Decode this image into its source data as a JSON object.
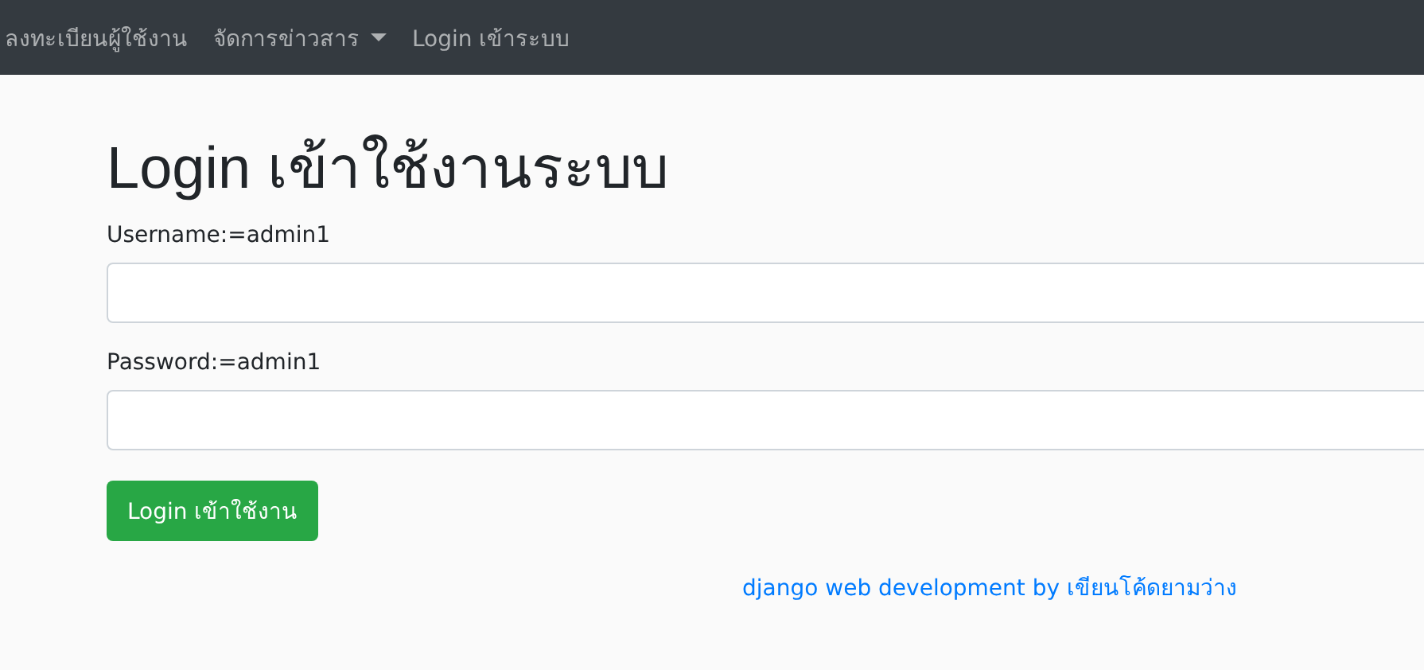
{
  "navbar": {
    "items": [
      {
        "label": "ลงทะเบียนผู้ใช้งาน",
        "kind": "link"
      },
      {
        "label": "จัดการข่าวสาร",
        "kind": "dropdown"
      },
      {
        "label": "Login เข้าระบบ",
        "kind": "link"
      }
    ]
  },
  "heading": "Login เข้าใช้งานระบบ",
  "fields": [
    {
      "label": "Username:=admin1"
    },
    {
      "label": "Password:=admin1"
    }
  ],
  "submit": "Login เข้าใช้งาน",
  "footer_link": "django web development by เขียนโค้ดยามว่าง"
}
